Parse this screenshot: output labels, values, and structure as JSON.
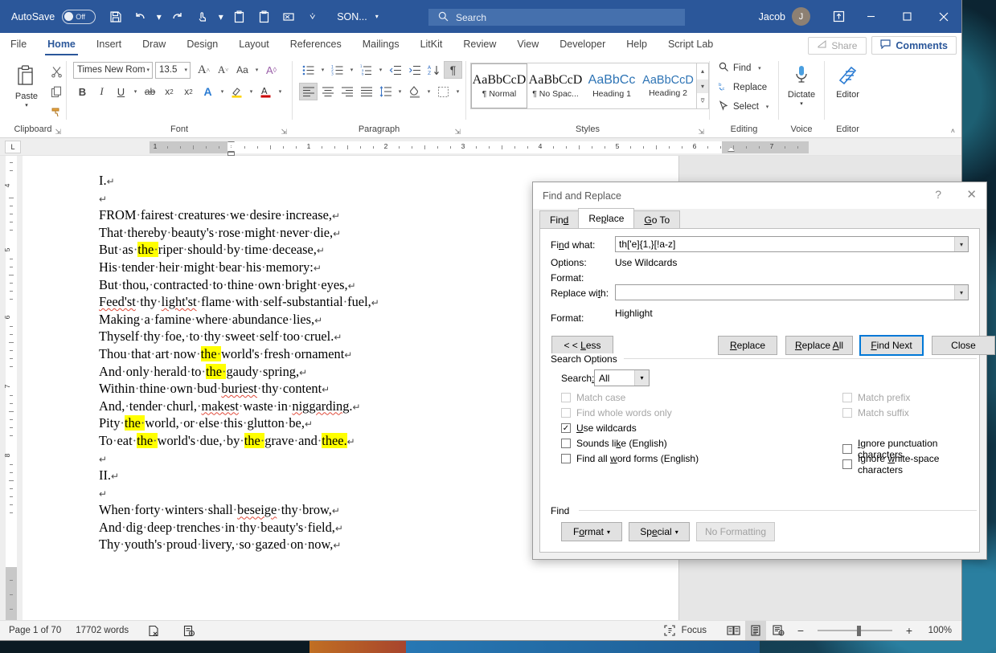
{
  "titlebar": {
    "autosave_label": "AutoSave",
    "autosave_state": "Off",
    "doc_name": "SON...",
    "user_name": "Jacob",
    "avatar_initial": "J",
    "quick_access": [
      "save-icon",
      "undo-icon",
      "redo-icon",
      "touch-mode-icon",
      "paste-icon",
      "copy-icon",
      "format-painter-icon",
      "customize-qat-icon"
    ],
    "window_buttons": [
      "minimize",
      "maximize",
      "close"
    ],
    "accent_color": "#2b579a"
  },
  "search": {
    "placeholder": "Search",
    "icon": "search-icon"
  },
  "tabs": [
    {
      "label": "File",
      "active": false
    },
    {
      "label": "Home",
      "active": true
    },
    {
      "label": "Insert",
      "active": false
    },
    {
      "label": "Draw",
      "active": false
    },
    {
      "label": "Design",
      "active": false
    },
    {
      "label": "Layout",
      "active": false
    },
    {
      "label": "References",
      "active": false
    },
    {
      "label": "Mailings",
      "active": false
    },
    {
      "label": "LitKit",
      "active": false
    },
    {
      "label": "Review",
      "active": false
    },
    {
      "label": "View",
      "active": false
    },
    {
      "label": "Developer",
      "active": false
    },
    {
      "label": "Help",
      "active": false
    },
    {
      "label": "Script Lab",
      "active": false
    }
  ],
  "tab_right": {
    "share_label": "Share",
    "comments_label": "Comments"
  },
  "ribbon": {
    "groups": [
      {
        "name": "Clipboard",
        "label": "Clipboard"
      },
      {
        "name": "Font",
        "label": "Font"
      },
      {
        "name": "Paragraph",
        "label": "Paragraph"
      },
      {
        "name": "Styles",
        "label": "Styles"
      },
      {
        "name": "Editing",
        "label": "Editing"
      },
      {
        "name": "Voice",
        "label": "Voice"
      },
      {
        "name": "Editor",
        "label": "Editor"
      }
    ],
    "clipboard": {
      "paste_label": "Paste"
    },
    "font": {
      "family": "Times New Rom",
      "size": "13.5"
    },
    "styles": [
      {
        "preview": "AaBbCcD",
        "name": "¶ Normal",
        "selected": true,
        "kind": "body"
      },
      {
        "preview": "AaBbCcD",
        "name": "¶ No Spac...",
        "selected": false,
        "kind": "body"
      },
      {
        "preview": "AaBbCc",
        "name": "Heading 1",
        "selected": false,
        "kind": "h1"
      },
      {
        "preview": "AaBbCcD",
        "name": "Heading 2",
        "selected": false,
        "kind": "h2"
      }
    ],
    "editing": [
      {
        "label": "Find",
        "icon": "search-icon",
        "caret": true
      },
      {
        "label": "Replace",
        "icon": "replace-icon",
        "caret": false
      },
      {
        "label": "Select",
        "icon": "select-arrow-icon",
        "caret": true
      }
    ],
    "voice": {
      "label": "Dictate",
      "icon": "microphone-icon"
    },
    "editor": {
      "label": "Editor",
      "icon": "editor-pen-icon"
    }
  },
  "ruler": {
    "h_numbers": [
      "1",
      "1",
      "2",
      "3",
      "4",
      "5",
      "6",
      "7"
    ],
    "v_numbers": [
      "4",
      "5",
      "6",
      "7",
      "8"
    ]
  },
  "document": {
    "lines": [
      {
        "segments": [
          {
            "t": "I."
          }
        ],
        "pilcrow": true
      },
      {
        "segments": [],
        "pilcrow": true
      },
      {
        "segments": [
          {
            "t": "FROM fairest creatures we desire increase,"
          }
        ],
        "pilcrow": true
      },
      {
        "segments": [
          {
            "t": "That thereby beauty's rose might never die,"
          }
        ],
        "pilcrow": true
      },
      {
        "segments": [
          {
            "t": "But as "
          },
          {
            "t": "the ",
            "hl": true
          },
          {
            "t": "riper should by time decease,"
          }
        ],
        "pilcrow": true
      },
      {
        "segments": [
          {
            "t": "His tender heir might bear his memory:"
          }
        ],
        "pilcrow": true
      },
      {
        "segments": [
          {
            "t": "But thou, contracted to thine own bright eyes,"
          }
        ],
        "pilcrow": true
      },
      {
        "segments": [
          {
            "t": "Feed'st",
            "sq": true
          },
          {
            "t": " thy "
          },
          {
            "t": "light'st",
            "sq": true
          },
          {
            "t": " flame with self-substantial fuel,"
          }
        ],
        "pilcrow": true
      },
      {
        "segments": [
          {
            "t": "Making a famine where abundance lies,"
          }
        ],
        "pilcrow": true
      },
      {
        "segments": [
          {
            "t": "Thyself thy foe, to thy sweet self too cruel."
          }
        ],
        "pilcrow": true
      },
      {
        "segments": [
          {
            "t": "Thou that art now "
          },
          {
            "t": "the ",
            "hl": true
          },
          {
            "t": "world's fresh ornament"
          }
        ],
        "pilcrow": true
      },
      {
        "segments": [
          {
            "t": "And only herald to "
          },
          {
            "t": "the ",
            "hl": true
          },
          {
            "t": "gaudy spring,"
          }
        ],
        "pilcrow": true
      },
      {
        "segments": [
          {
            "t": "Within thine own bud "
          },
          {
            "t": "buriest",
            "sq": true
          },
          {
            "t": " thy content"
          }
        ],
        "pilcrow": true
      },
      {
        "segments": [
          {
            "t": "And, tender churl, "
          },
          {
            "t": "makest",
            "sq": true
          },
          {
            "t": " waste in "
          },
          {
            "t": "niggarding",
            "sq": true
          },
          {
            "t": "."
          }
        ],
        "pilcrow": true
      },
      {
        "segments": [
          {
            "t": "Pity "
          },
          {
            "t": "the ",
            "hl": true
          },
          {
            "t": "world, or else this glutton be,"
          }
        ],
        "pilcrow": true
      },
      {
        "segments": [
          {
            "t": "To eat "
          },
          {
            "t": "the ",
            "hl": true
          },
          {
            "t": "world's due, by "
          },
          {
            "t": "the ",
            "hl": true
          },
          {
            "t": "grave and "
          },
          {
            "t": "thee.",
            "hl": true
          }
        ],
        "pilcrow": true
      },
      {
        "segments": [],
        "pilcrow": true
      },
      {
        "segments": [
          {
            "t": "II."
          }
        ],
        "pilcrow": true
      },
      {
        "segments": [],
        "pilcrow": true
      },
      {
        "segments": [
          {
            "t": "When forty winters shall "
          },
          {
            "t": "beseige",
            "sq": true
          },
          {
            "t": " thy brow,"
          }
        ],
        "pilcrow": true
      },
      {
        "segments": [
          {
            "t": "And dig deep trenches in thy beauty's field,"
          }
        ],
        "pilcrow": true
      },
      {
        "segments": [
          {
            "t": "Thy youth's proud livery, so gazed on now,"
          }
        ],
        "pilcrow": true
      }
    ],
    "highlight_color": "#ffff00"
  },
  "statusbar": {
    "page_label": "Page 1 of 70",
    "word_count": "17702 words",
    "proofing_icon": "proofing-errors-icon",
    "accessibility_icon": "accessibility-icon",
    "focus_label": "Focus",
    "views": [
      "read-mode-icon",
      "print-layout-icon",
      "web-layout-icon"
    ],
    "active_view": "print-layout-icon",
    "zoom_minus": "−",
    "zoom_plus": "+",
    "zoom_level": "100%"
  },
  "find_replace": {
    "title": "Find and Replace",
    "help_glyph": "?",
    "close_glyph": "✕",
    "tabs": [
      {
        "label": "Find",
        "active": false
      },
      {
        "label": "Replace",
        "active": true
      },
      {
        "label": "Go To",
        "active": false
      }
    ],
    "find_what_label": "Find what:",
    "find_what_value": "th['e]{1,}[!a-z]",
    "options_label": "Options:",
    "options_value": "Use Wildcards",
    "format_label_1": "Format:",
    "format_value_1": "",
    "replace_with_label": "Replace with:",
    "replace_with_value": "",
    "format_label_2": "Format:",
    "format_value_2": "Highlight",
    "less_button": "< < Less",
    "buttons": [
      {
        "label": "Replace",
        "state": "normal"
      },
      {
        "label": "Replace All",
        "state": "normal"
      },
      {
        "label": "Find Next",
        "state": "focused"
      },
      {
        "label": "Close",
        "state": "normal"
      }
    ],
    "search_options_title": "Search Options",
    "search_label": "Search:",
    "search_value": "All",
    "checkboxes_left": [
      {
        "label": "Match case",
        "checked": false,
        "disabled": true
      },
      {
        "label": "Find whole words only",
        "checked": false,
        "disabled": true
      },
      {
        "label": "Use wildcards",
        "checked": true,
        "disabled": false
      },
      {
        "label": "Sounds like (English)",
        "checked": false,
        "disabled": false
      },
      {
        "label": "Find all word forms (English)",
        "checked": false,
        "disabled": false
      }
    ],
    "checkboxes_right": [
      {
        "label": "Match prefix",
        "checked": false,
        "disabled": true
      },
      {
        "label": "Match suffix",
        "checked": false,
        "disabled": true
      },
      {
        "label": "Ignore punctuation characters",
        "checked": false,
        "disabled": false
      },
      {
        "label": "Ignore white-space characters",
        "checked": false,
        "disabled": false
      }
    ],
    "find_group_title": "Find",
    "format_button": "Format",
    "special_button": "Special",
    "no_formatting_button": "No Formatting",
    "focus_color": "#0078d7"
  }
}
